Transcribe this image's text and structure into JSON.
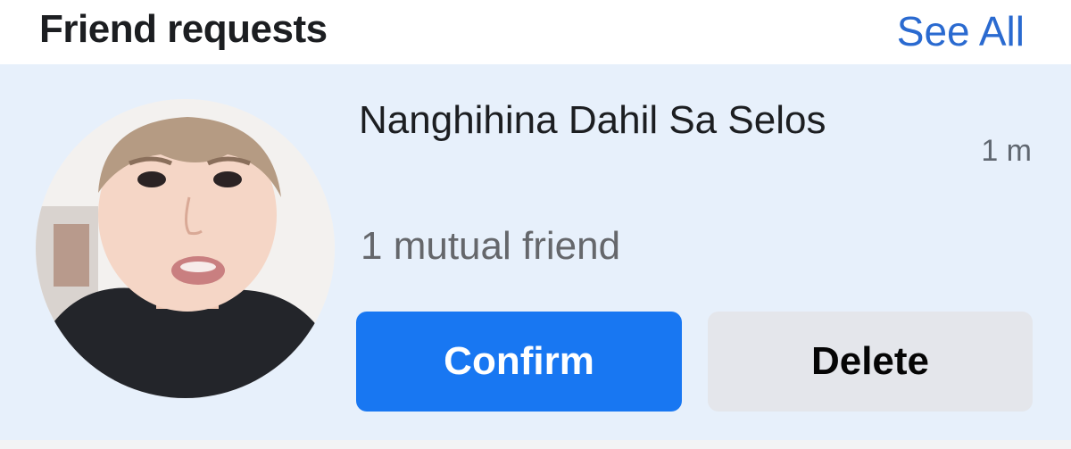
{
  "header": {
    "title": "Friend requests",
    "see_all_label": "See All"
  },
  "request": {
    "name": "Nanghihina Dahil Sa Selos",
    "time": "1 m",
    "mutual_friends": "1 mutual friend",
    "confirm_label": "Confirm",
    "delete_label": "Delete"
  },
  "colors": {
    "accent": "#1877f2",
    "link": "#2a6ad0",
    "card_background": "#e7f0fb",
    "secondary_button": "#e4e6eb"
  }
}
